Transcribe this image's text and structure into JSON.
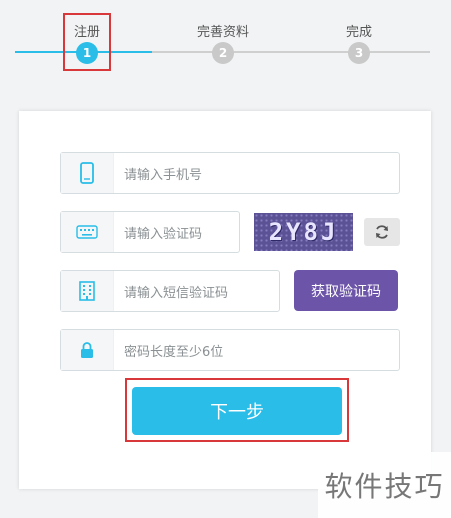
{
  "steps": [
    {
      "label": "注册",
      "number": "1"
    },
    {
      "label": "完善资料",
      "number": "2"
    },
    {
      "label": "完成",
      "number": "3"
    }
  ],
  "form": {
    "phone_placeholder": "请输入手机号",
    "captcha_placeholder": "请输入验证码",
    "captcha_text": "2Y8J",
    "sms_placeholder": "请输入短信验证码",
    "sms_button": "获取验证码",
    "password_placeholder": "密码长度至少6位",
    "next_button": "下一步"
  },
  "watermark": "软件技巧",
  "colors": {
    "accent": "#29bde8",
    "sms_button": "#6c55a9",
    "highlight": "#d9383a"
  },
  "icons": [
    "phone-icon",
    "keyboard-icon",
    "building-icon",
    "lock-icon",
    "refresh-icon"
  ]
}
